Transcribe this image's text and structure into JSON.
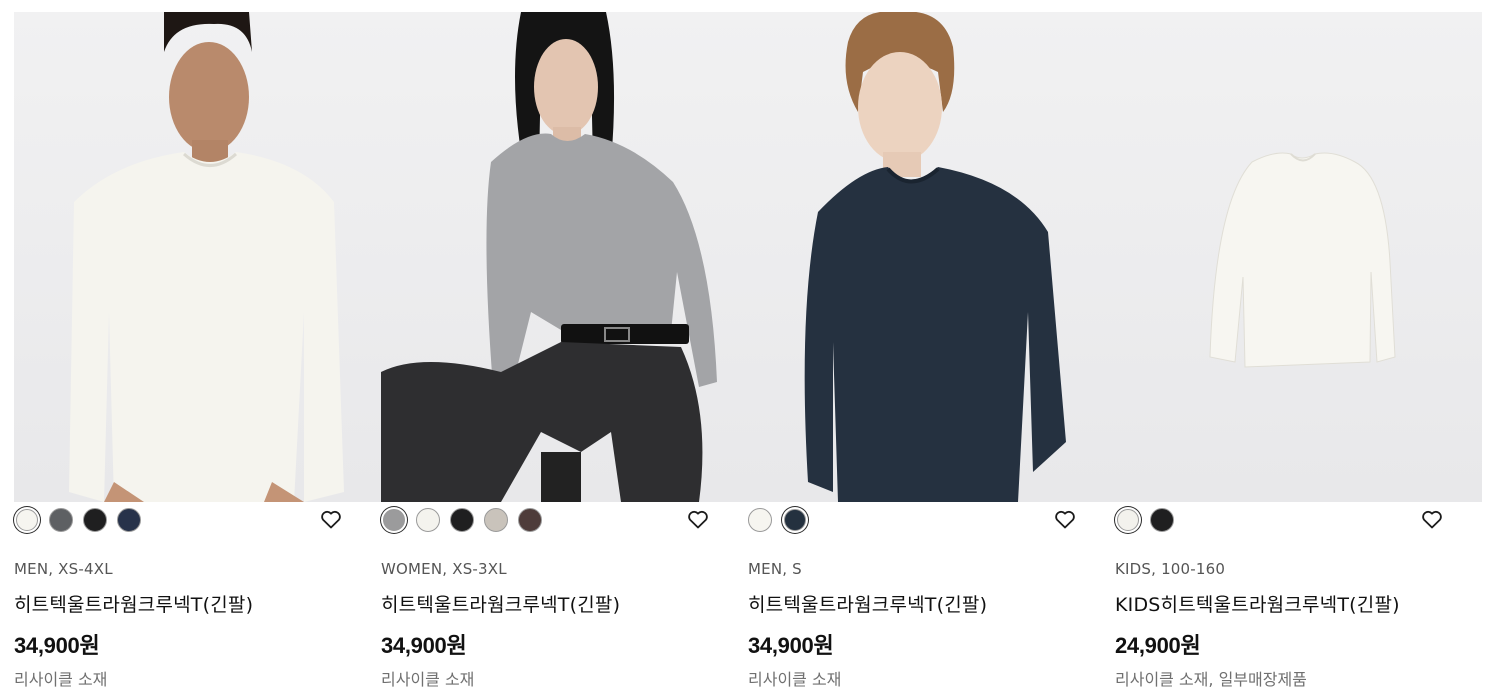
{
  "products": [
    {
      "category": "MEN, XS-4XL",
      "name": "히트텍울트라웜크루넥T(긴팔)",
      "price": "34,900원",
      "note": "리사이클 소재",
      "swatches": [
        "#f6f5f0",
        "#5e6063",
        "#1f1f20",
        "#27324a"
      ],
      "selected": 0,
      "image": "man-white-longsleeve"
    },
    {
      "category": "WOMEN, XS-3XL",
      "name": "히트텍울트라웜크루넥T(긴팔)",
      "price": "34,900원",
      "note": "리사이클 소재",
      "swatches": [
        "#9b9b9c",
        "#f4f3ee",
        "#1f1f20",
        "#c9c3bb",
        "#4e3c3a"
      ],
      "selected": 0,
      "image": "woman-gray-longsleeve"
    },
    {
      "category": "MEN, S",
      "name": "히트텍울트라웜크루넥T(긴팔)",
      "price": "34,900원",
      "note": "리사이클 소재",
      "swatches": [
        "#f6f5f0",
        "#24313f"
      ],
      "selected": 1,
      "image": "man-navy-longsleeve"
    },
    {
      "category": "KIDS, 100-160",
      "name": "KIDS히트텍울트라웜크루넥T(긴팔)",
      "price": "24,900원",
      "note": "리사이클 소재, 일부매장제품",
      "swatches": [
        "#f3f2ed",
        "#1f1f20"
      ],
      "selected": 0,
      "image": "kids-white-longsleeve"
    }
  ],
  "icons": {
    "favorite": "heart-outline-icon"
  }
}
